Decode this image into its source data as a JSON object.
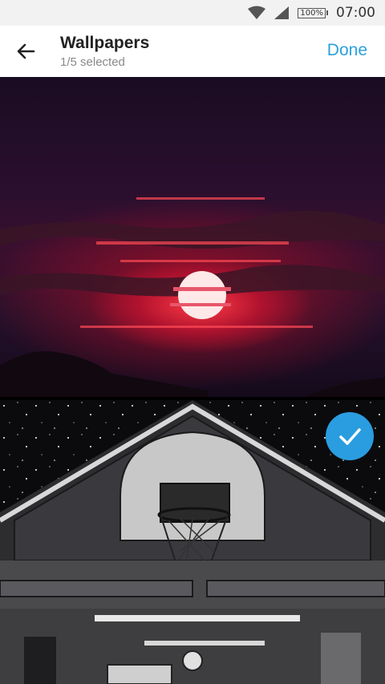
{
  "status_bar": {
    "battery": "100%",
    "time": "07:00"
  },
  "header": {
    "title": "Wallpapers",
    "subtitle": "1/5 selected",
    "done_label": "Done"
  },
  "wallpapers": [
    {
      "description": "red sunset",
      "selected": false
    },
    {
      "description": "basketball hoop garage",
      "selected": true
    }
  ],
  "colors": {
    "accent": "#2aa1de",
    "check": "#2a9de0"
  },
  "icons": {
    "back": "arrow-back-icon",
    "check": "checkmark-icon",
    "wifi": "wifi-icon",
    "signal": "signal-icon",
    "battery": "battery-icon"
  }
}
